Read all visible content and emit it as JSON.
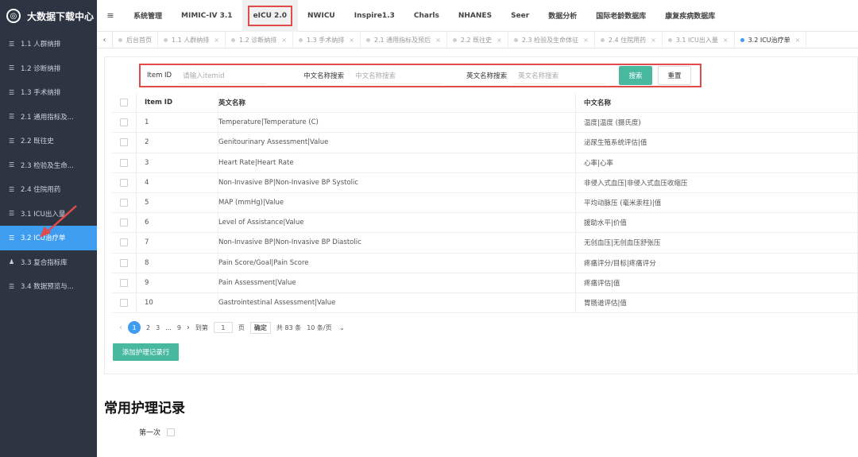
{
  "app": {
    "title": "大数据下载中心",
    "logo_glyph": "◎"
  },
  "sidebar": {
    "items": [
      {
        "label": "1.1 人群纳排",
        "icon": "list-icon"
      },
      {
        "label": "1.2 诊断纳排",
        "icon": "list-icon"
      },
      {
        "label": "1.3 手术纳排",
        "icon": "list-icon"
      },
      {
        "label": "2.1 通用指标及...",
        "icon": "list-icon"
      },
      {
        "label": "2.2 既往史",
        "icon": "list-icon"
      },
      {
        "label": "2.3 检验及生命...",
        "icon": "list-icon"
      },
      {
        "label": "2.4 住院用药",
        "icon": "list-icon"
      },
      {
        "label": "3.1 ICU出入量",
        "icon": "list-icon"
      },
      {
        "label": "3.2 ICU治疗单",
        "icon": "list-icon",
        "active": true
      },
      {
        "label": "3.3 复合指标库",
        "icon": "person-icon"
      },
      {
        "label": "3.4 数据预览与...",
        "icon": "list-icon"
      }
    ]
  },
  "topnav": {
    "menu_glyph": "≡",
    "items": [
      "系统管理",
      "MIMIC-IV 3.1",
      "eICU 2.0",
      "NWICU",
      "Inspire1.3",
      "Charls",
      "NHANES",
      "Seer",
      "数据分析",
      "国际老龄数据库",
      "康复疾病数据库"
    ],
    "active_index": 2
  },
  "tabs": {
    "back_glyph": "‹",
    "items": [
      "后台首页",
      "1.1 人群纳排",
      "1.2 诊断纳排",
      "1.3 手术纳排",
      "2.1 通用指标及预后",
      "2.2 既往史",
      "2.3 检验及生命体征",
      "2.4 住院用药",
      "3.1 ICU出入量",
      "3.2 ICU治疗单"
    ],
    "close_glyph": "×"
  },
  "search": {
    "itemid_label": "Item ID",
    "itemid_placeholder": "请输入itemid",
    "cn_label": "中文名称搜索",
    "cn_placeholder": "中文名称搜索",
    "en_label": "英文名称搜索",
    "en_placeholder": "英文名称搜索",
    "search_button": "搜索",
    "reset_button": "重置"
  },
  "table": {
    "headers": {
      "id": "Item ID",
      "en": "英文名称",
      "cn": "中文名称"
    },
    "rows": [
      {
        "id": "1",
        "en": "Temperature|Temperature (C)",
        "cn": "温度|温度 (摄氏度)"
      },
      {
        "id": "2",
        "en": "Genitourinary Assessment|Value",
        "cn": "泌尿生殖系统评估|值"
      },
      {
        "id": "3",
        "en": "Heart Rate|Heart Rate",
        "cn": "心率|心率"
      },
      {
        "id": "4",
        "en": "Non-Invasive BP|Non-Invasive BP Systolic",
        "cn": "非侵入式血压|非侵入式血压收缩压"
      },
      {
        "id": "5",
        "en": "MAP (mmHg)|Value",
        "cn": "平均动脉压 (毫米汞柱)|值"
      },
      {
        "id": "6",
        "en": "Level of Assistance|Value",
        "cn": "援助水平|价值"
      },
      {
        "id": "7",
        "en": "Non-Invasive BP|Non-Invasive BP Diastolic",
        "cn": "无创血压|无创血压舒张压"
      },
      {
        "id": "8",
        "en": "Pain Score/Goal|Pain Score",
        "cn": "疼痛评分/目标|疼痛评分"
      },
      {
        "id": "9",
        "en": "Pain Assessment|Value",
        "cn": "疼痛评估|值"
      },
      {
        "id": "10",
        "en": "Gastrointestinal Assessment|Value",
        "cn": "胃肠道评估|值"
      }
    ]
  },
  "pager": {
    "prev": "‹",
    "current": "1",
    "p2": "2",
    "p3": "3",
    "ellipsis": "...",
    "last": "9",
    "next": "›",
    "goto_label": "到第",
    "goto_value": "1",
    "page_unit": "页",
    "confirm": "确定",
    "total": "共 83 条",
    "page_size": "10 条/页"
  },
  "add_button": "添加护理记录行",
  "section": {
    "title": "常用护理记录",
    "first_label": "第一次"
  },
  "colors": {
    "sidebar_bg": "#2d3542",
    "active_blue": "#3f9df0",
    "green_button": "#48b99f",
    "highlight_red": "#e24b4b"
  }
}
